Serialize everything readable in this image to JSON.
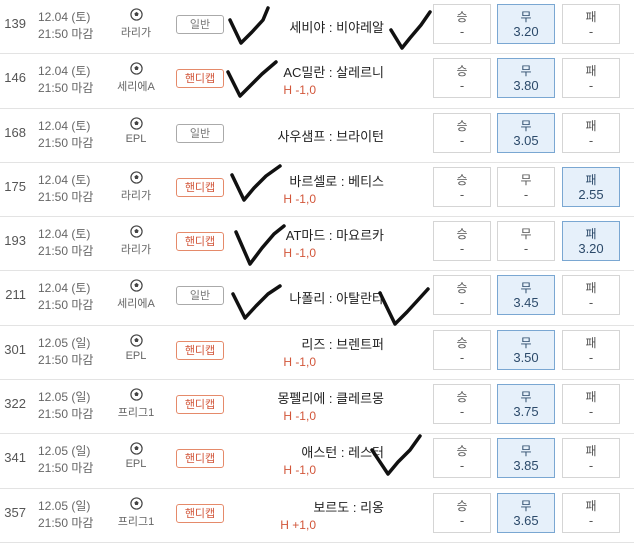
{
  "rows": [
    {
      "num": "139",
      "date": "12.04 (토)",
      "time": "21:50 마감",
      "league": "라리가",
      "type": "일반",
      "home": "세비야",
      "away": "비야레알",
      "handicap": "",
      "odds": [
        {
          "label": "승",
          "value": "-",
          "selected": false
        },
        {
          "label": "무",
          "value": "3.20",
          "selected": true
        },
        {
          "label": "패",
          "value": "-",
          "selected": false
        }
      ]
    },
    {
      "num": "146",
      "date": "12.04 (토)",
      "time": "21:50 마감",
      "league": "세리에A",
      "type": "핸디캡",
      "home": "AC밀란",
      "away": "살레르니",
      "handicap": "H -1,0",
      "odds": [
        {
          "label": "승",
          "value": "-",
          "selected": false
        },
        {
          "label": "무",
          "value": "3.80",
          "selected": true
        },
        {
          "label": "패",
          "value": "-",
          "selected": false
        }
      ]
    },
    {
      "num": "168",
      "date": "12.04 (토)",
      "time": "21:50 마감",
      "league": "EPL",
      "type": "일반",
      "home": "사우샘프",
      "away": "브라이턴",
      "handicap": "",
      "odds": [
        {
          "label": "승",
          "value": "-",
          "selected": false
        },
        {
          "label": "무",
          "value": "3.05",
          "selected": true
        },
        {
          "label": "패",
          "value": "-",
          "selected": false
        }
      ]
    },
    {
      "num": "175",
      "date": "12.04 (토)",
      "time": "21:50 마감",
      "league": "라리가",
      "type": "핸디캡",
      "home": "바르셀로",
      "away": "베티스",
      "handicap": "H -1,0",
      "odds": [
        {
          "label": "승",
          "value": "-",
          "selected": false
        },
        {
          "label": "무",
          "value": "-",
          "selected": false
        },
        {
          "label": "패",
          "value": "2.55",
          "selected": true
        }
      ]
    },
    {
      "num": "193",
      "date": "12.04 (토)",
      "time": "21:50 마감",
      "league": "라리가",
      "type": "핸디캡",
      "home": "AT마드",
      "away": "마요르카",
      "handicap": "H -1,0",
      "odds": [
        {
          "label": "승",
          "value": "-",
          "selected": false
        },
        {
          "label": "무",
          "value": "-",
          "selected": false
        },
        {
          "label": "패",
          "value": "3.20",
          "selected": true
        }
      ]
    },
    {
      "num": "211",
      "date": "12.04 (토)",
      "time": "21:50 마감",
      "league": "세리에A",
      "type": "일반",
      "home": "나폴리",
      "away": "아탈란타",
      "handicap": "",
      "odds": [
        {
          "label": "승",
          "value": "-",
          "selected": false
        },
        {
          "label": "무",
          "value": "3.45",
          "selected": true
        },
        {
          "label": "패",
          "value": "-",
          "selected": false
        }
      ]
    },
    {
      "num": "301",
      "date": "12.05 (일)",
      "time": "21:50 마감",
      "league": "EPL",
      "type": "핸디캡",
      "home": "리즈",
      "away": "브렌트퍼",
      "handicap": "H -1,0",
      "odds": [
        {
          "label": "승",
          "value": "-",
          "selected": false
        },
        {
          "label": "무",
          "value": "3.50",
          "selected": true
        },
        {
          "label": "패",
          "value": "-",
          "selected": false
        }
      ]
    },
    {
      "num": "322",
      "date": "12.05 (일)",
      "time": "21:50 마감",
      "league": "프리그1",
      "type": "핸디캡",
      "home": "몽펠리에",
      "away": "클레르몽",
      "handicap": "H -1,0",
      "odds": [
        {
          "label": "승",
          "value": "-",
          "selected": false
        },
        {
          "label": "무",
          "value": "3.75",
          "selected": true
        },
        {
          "label": "패",
          "value": "-",
          "selected": false
        }
      ]
    },
    {
      "num": "341",
      "date": "12.05 (일)",
      "time": "21:50 마감",
      "league": "EPL",
      "type": "핸디캡",
      "home": "애스턴",
      "away": "레스터",
      "handicap": "H -1,0",
      "odds": [
        {
          "label": "승",
          "value": "-",
          "selected": false
        },
        {
          "label": "무",
          "value": "3.85",
          "selected": true
        },
        {
          "label": "패",
          "value": "-",
          "selected": false
        }
      ]
    },
    {
      "num": "357",
      "date": "12.05 (일)",
      "time": "21:50 마감",
      "league": "프리그1",
      "type": "핸디캡",
      "home": "보르도",
      "away": "리옹",
      "handicap": "H +1,0",
      "odds": [
        {
          "label": "승",
          "value": "-",
          "selected": false
        },
        {
          "label": "무",
          "value": "3.65",
          "selected": true
        },
        {
          "label": "패",
          "value": "-",
          "selected": false
        }
      ]
    }
  ],
  "separator": " : ",
  "colors": {
    "selected_bg": "#e6f0fa",
    "selected_border": "#7aa7d2",
    "handicap": "#d2563a",
    "ink": "#111111"
  },
  "icons": {
    "league": "soccer-ball-icon",
    "mark": "checkmark-scribble-icon"
  }
}
